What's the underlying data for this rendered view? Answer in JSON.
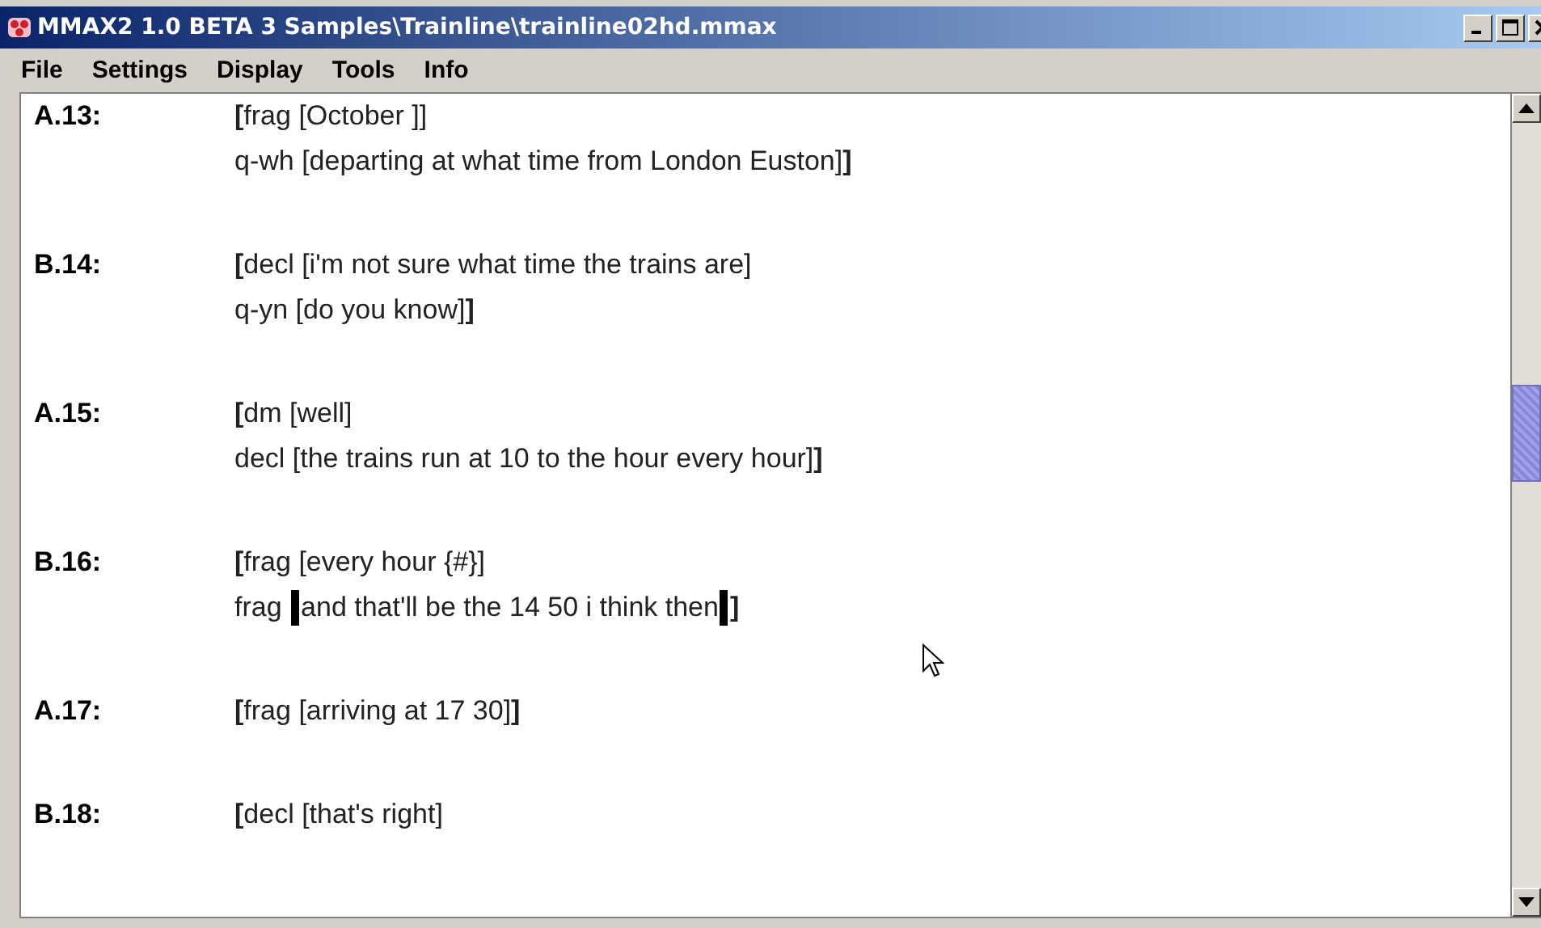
{
  "window": {
    "title": "MMAX2 1.0 BETA 3 Samples\\Trainline\\trainline02hd.mmax"
  },
  "menu": [
    "File",
    "Settings",
    "Display",
    "Tools",
    "Info"
  ],
  "utterances": [
    {
      "label": "A.13:",
      "lines": [
        {
          "text": "**[**frag [October ]]"
        },
        {
          "text": "q-wh [departing at what time from London Euston]**]**"
        }
      ]
    },
    {
      "label": "B.14:",
      "lines": [
        {
          "text": "**[**decl [i'm not sure what time the trains are]"
        },
        {
          "text": "q-yn [do you know]**]**"
        }
      ]
    },
    {
      "label": "A.15:",
      "lines": [
        {
          "text": "**[**dm [well]"
        },
        {
          "text": "decl [the trains run at 10 to the hour every hour]**]**"
        }
      ]
    },
    {
      "label": "B.16:",
      "lines": [
        {
          "text": "**[**frag [every hour {#}]"
        },
        {
          "text": "frag ",
          "marked": "and that'll be the 14 50 i think then",
          "after": "**]**"
        }
      ]
    },
    {
      "label": "A.17:",
      "lines": [
        {
          "text": "**[**frag [arriving at 17 30]**]**"
        }
      ]
    },
    {
      "label": "B.18:",
      "lines": [
        {
          "text": "**[**decl [that's right]"
        }
      ]
    }
  ]
}
